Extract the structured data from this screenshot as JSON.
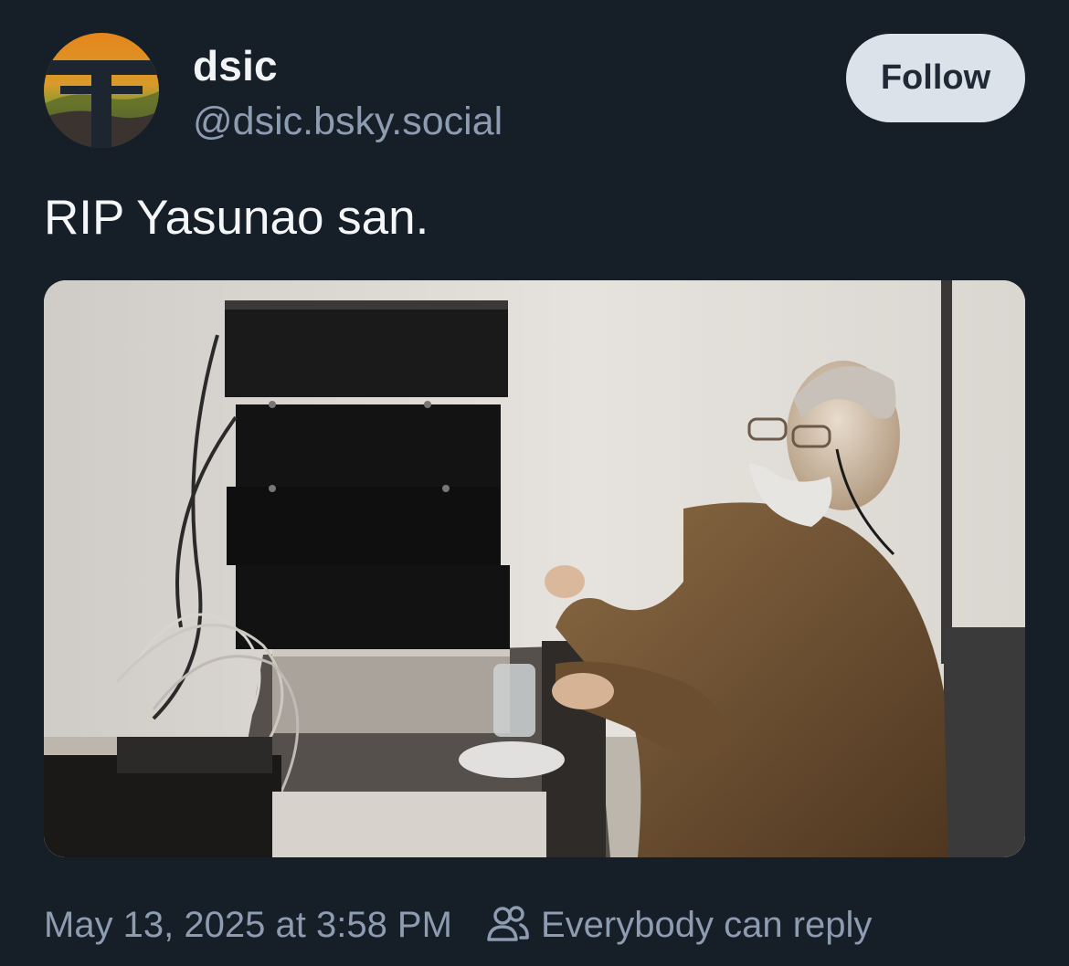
{
  "post": {
    "author": {
      "display_name": "dsic",
      "handle": "@dsic.bsky.social",
      "avatar_icon": "torii-gate-avatar"
    },
    "follow_label": "Follow",
    "text": "RIP Yasunao san.",
    "media": {
      "type": "photo",
      "icon": "photo-image"
    },
    "timestamp": "May 13, 2025 at 3:58 PM",
    "reply_setting": {
      "icon": "people-icon",
      "label": "Everybody can reply"
    }
  },
  "colors": {
    "background": "#161e27",
    "muted_text": "#8d9cb0",
    "follow_button_bg": "#dce2ea",
    "follow_button_text": "#1f2a36"
  }
}
